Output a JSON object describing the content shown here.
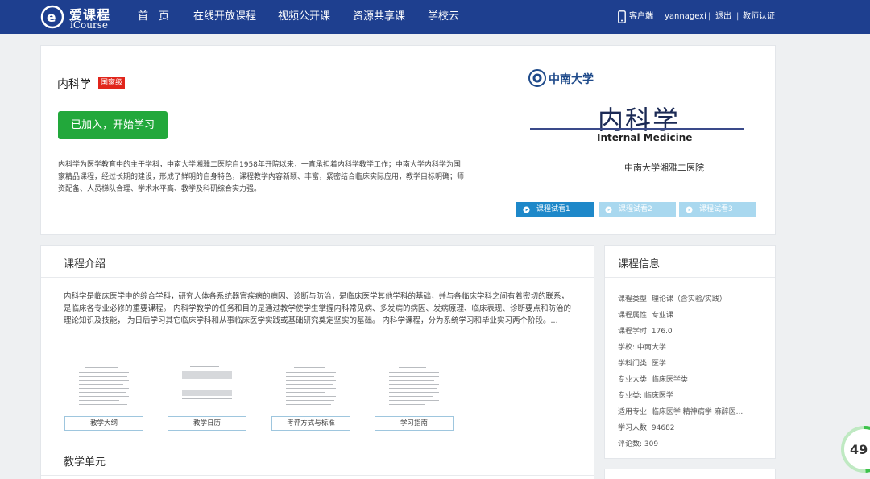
{
  "header": {
    "logo_cn": "爱课程",
    "logo_en": "iCourse",
    "nav": [
      "首　页",
      "在线开放课程",
      "视频公开课",
      "资源共享课",
      "学校云"
    ],
    "client_label": "客户端",
    "username": "yannagexi",
    "logout": "退出",
    "teacher_auth": "教师认证",
    "bg_color": "#1e3f8f"
  },
  "course": {
    "title": "内科学",
    "badge": "国家级",
    "join_button": "已加入，开始学习",
    "description": "内科学为医学教育中的主干学科，中南大学湘雅二医院自1958年开院以来，一直承担着内科学教学工作；中南大学内科学为国家精品课程，经过长期的建设，形成了鲜明的自身特色，课程教学内容新颖、丰富，紧密结合临床实际应用，教学目标明确；师资配备、人员梯队合理、学术水平高、教学及科研综合实力强。",
    "accent_green": "#22a83b"
  },
  "cover": {
    "university": "中南大学",
    "title": "内科学",
    "english": "Internal Medicine",
    "hospital": "中南大学湘雅二医院"
  },
  "trials": [
    {
      "label": "课程试看1",
      "color": "#1e88c9"
    },
    {
      "label": "课程试看2",
      "color": "#a9d8ef"
    },
    {
      "label": "课程试看3",
      "color": "#a9d8ef"
    }
  ],
  "intro": {
    "heading": "课程介绍",
    "text": "内科学是临床医学中的综合学科，研究人体各系统器官疾病的病因、诊断与防治，是临床医学其他学科的基础，并与各临床学科之间有着密切的联系，是临床各专业必修的重要课程。 内科学教学的任务和目的是通过教学使学生掌握内科常见病、多发病的病因、发病原理、临床表现、诊断要点和防治的理论知识及技能， 为日后学习其它临床学科和从事临床医学实践或基础研究奠定坚实的基础。 内科学课程，分为系统学习和毕业实习两个阶段。...",
    "docs": [
      "教学大纲",
      "教学日历",
      "考评方式与标准",
      "学习指南"
    ],
    "units_heading": "教学单元"
  },
  "info": {
    "heading": "课程信息",
    "items": [
      "课程类型: 理论课（含实验/实践）",
      "课程属性: 专业课",
      "课程学时: 176.0",
      "学校: 中南大学",
      "学科门类: 医学",
      "专业大类: 临床医学类",
      "专业类: 临床医学",
      "适用专业: 临床医学 精神病学 麻醉医...",
      "学习人数: 94682",
      "评论数: 309"
    ]
  },
  "progress": {
    "text": "49",
    "value_percent": 49
  }
}
